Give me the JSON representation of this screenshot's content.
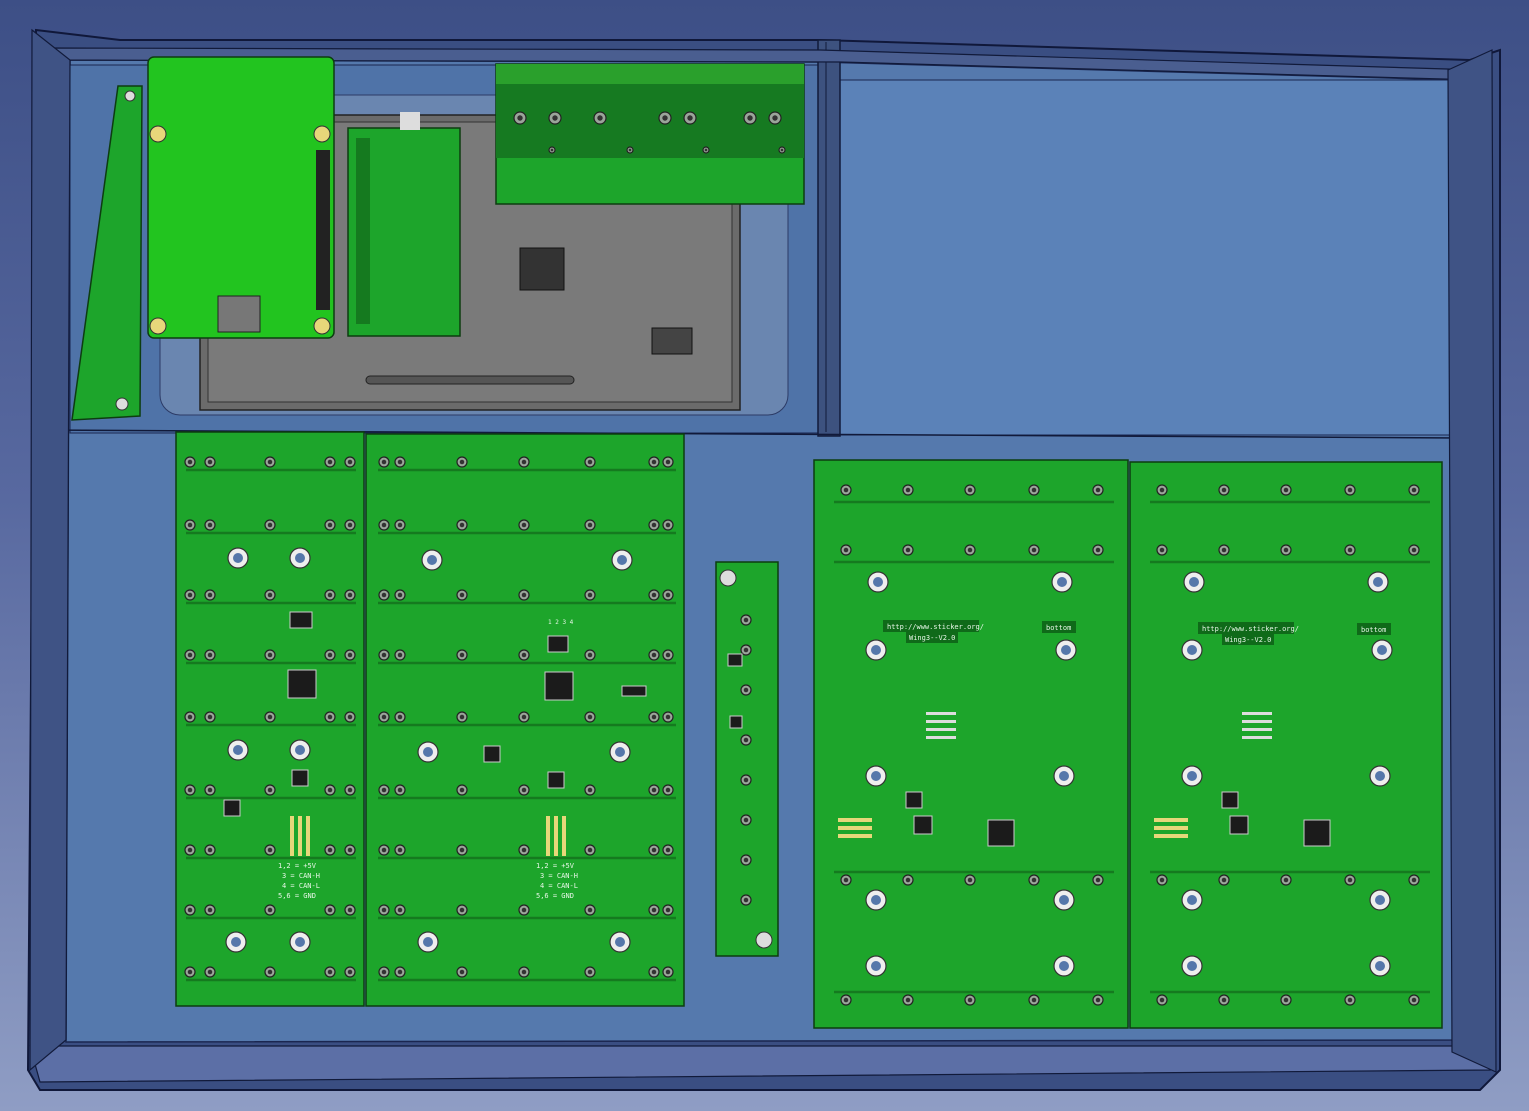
{
  "scene": {
    "colors": {
      "background_top": "#3d4f86",
      "background_bottom": "#8f9dc4",
      "enclosure_floor": "#5577aa",
      "enclosure_wall": "#35497c",
      "pcb_green": "#1da52b",
      "pcb_bright": "#22c41f",
      "pad_gold": "#e7d77a",
      "panel_grey": "#6b6b6b"
    }
  },
  "silkscreen": {
    "pinout_left": [
      "1,2 = +5V",
      "3 = CAN-H",
      "4 = CAN-L",
      "5,6 = GND"
    ],
    "pinout_mid": [
      "1,2 = +5V",
      "3 = CAN-H",
      "4 = CAN-L",
      "5,6 = GND"
    ],
    "chip_label": "1 2 3 4",
    "wing_left_url": "http://www.sticker.org/",
    "wing_left_name": "Wing3--V2.0",
    "wing_left_side": "bottom",
    "wing_right_url": "http://www.sticker.org/",
    "wing_right_name": "Wing3--V2.0",
    "wing_right_side": "bottom"
  }
}
